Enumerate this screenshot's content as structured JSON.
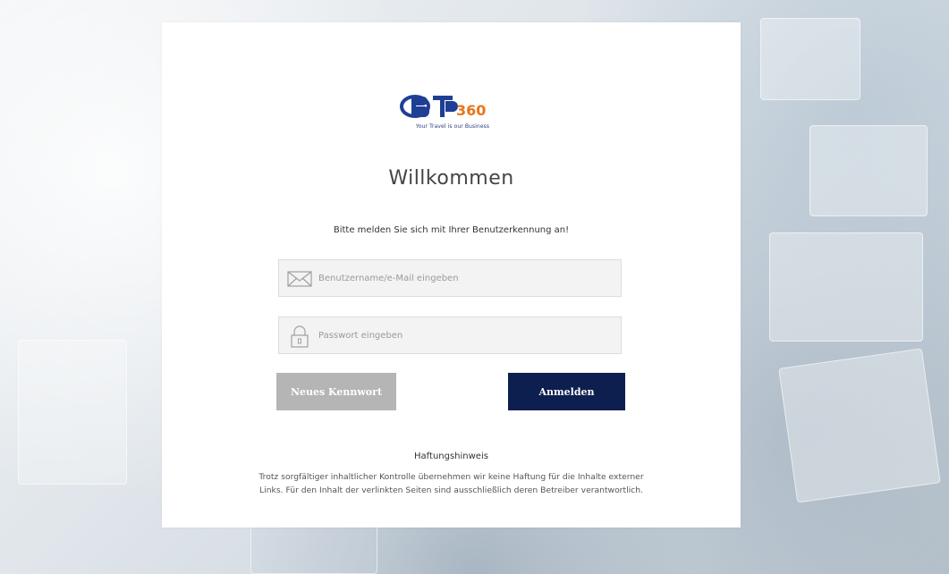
{
  "logo": {
    "text": "BT360",
    "tagline": "Your Travel is our Business",
    "colors": {
      "primary": "#1f3f95",
      "accent": "#e8751a"
    }
  },
  "welcome": {
    "title": "Willkommen",
    "subtitle": "Bitte melden Sie sich mit Ihrer Benutzerkennung an!"
  },
  "form": {
    "username": {
      "placeholder": "Benutzername/e-Mail eingeben",
      "value": "",
      "icon": "envelope-icon"
    },
    "password": {
      "placeholder": "Passwort eingeben",
      "value": "",
      "icon": "lock-icon"
    },
    "new_password_label": "Neues Kennwort",
    "login_label": "Anmelden"
  },
  "disclaimer": {
    "title": "Haftungshinweis",
    "line1": "Trotz sorgfältiger inhaltlicher Kontrolle übernehmen wir keine Haftung für die Inhalte externer",
    "line2": "Links. Für den Inhalt der verlinkten Seiten sind ausschließlich deren Betreiber verantwortlich."
  },
  "colors": {
    "primary_button": "#0c1f4f",
    "secondary_button": "#b5b5b5",
    "card_background": "#ffffff"
  }
}
